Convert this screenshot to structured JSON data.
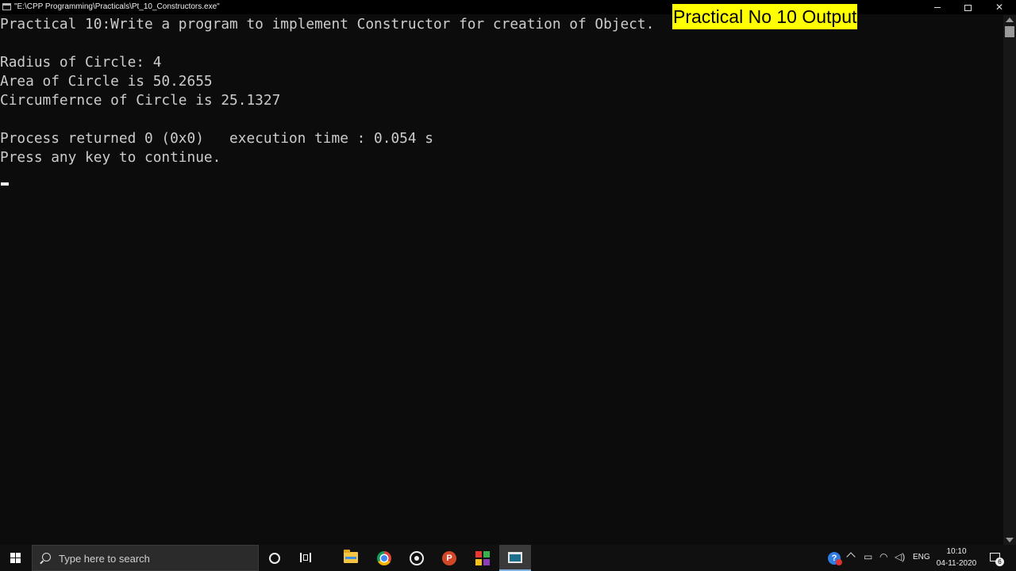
{
  "window": {
    "title": "\"E:\\CPP Programming\\Practicals\\Pt_10_Constructors.exe\""
  },
  "overlay_label": "Practical No 10 Output",
  "console": {
    "lines": [
      "Practical 10:Write a program to implement Constructor for creation of Object.",
      "",
      "Radius of Circle: 4",
      "Area of Circle is 50.2655",
      "Circumfernce of Circle is 25.1327",
      "",
      "Process returned 0 (0x0)   execution time : 0.054 s",
      "Press any key to continue."
    ]
  },
  "taskbar": {
    "search_placeholder": "Type here to search",
    "apps": [
      "cortana-icon",
      "task-view-icon",
      "file-explorer-icon",
      "chrome-icon",
      "media-player-icon",
      "powerpoint-icon",
      "tiles-app-icon",
      "console-app-icon"
    ],
    "tray": {
      "language": "ENG",
      "time": "10:10",
      "date": "04-11-2020",
      "notification_count": "6"
    }
  },
  "colors": {
    "console_bg": "#0c0c0c",
    "console_text": "#cccccc",
    "overlay_bg": "#ffff00"
  }
}
